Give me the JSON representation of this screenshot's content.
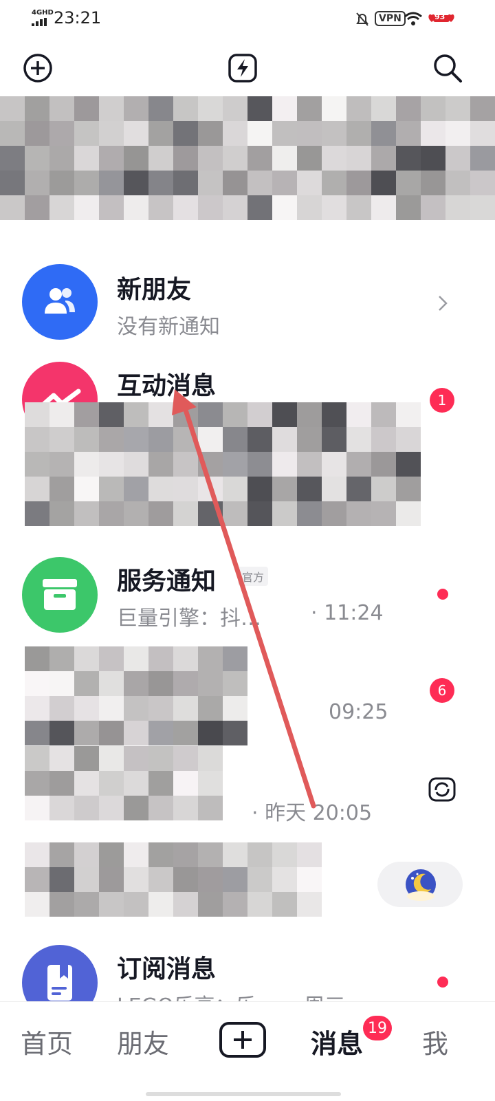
{
  "status_bar": {
    "network": "4GHD",
    "time": "23:21",
    "vpn": "VPN",
    "battery_level": "93"
  },
  "header": {
    "add_icon": "plus-circle-icon",
    "flash_icon": "lightning-icon",
    "search_icon": "search-icon"
  },
  "rows": {
    "new_friends": {
      "title": "新朋友",
      "subtitle": "没有新通知"
    },
    "interactions": {
      "title": "互动消息",
      "badge": "1"
    },
    "service": {
      "title": "服务通知",
      "tag": "官方",
      "subtitle": "巨量引擎：抖…",
      "time": "· 11:24"
    },
    "chat1": {
      "time": "09:25",
      "badge": "6"
    },
    "chat2": {
      "time": "· 昨天 20:05"
    },
    "subscription": {
      "title": "订阅消息",
      "subtitle": "LEGO乐高：乐……  周三"
    }
  },
  "bottom_nav": {
    "home": "首页",
    "friends": "朋友",
    "messages": "消息",
    "messages_badge": "19",
    "me": "我"
  },
  "colors": {
    "accent": "#fe2c55",
    "blue": "#2f6bf5",
    "pink": "#f4356b",
    "green": "#3cc76a",
    "indigo": "#5163d6"
  }
}
